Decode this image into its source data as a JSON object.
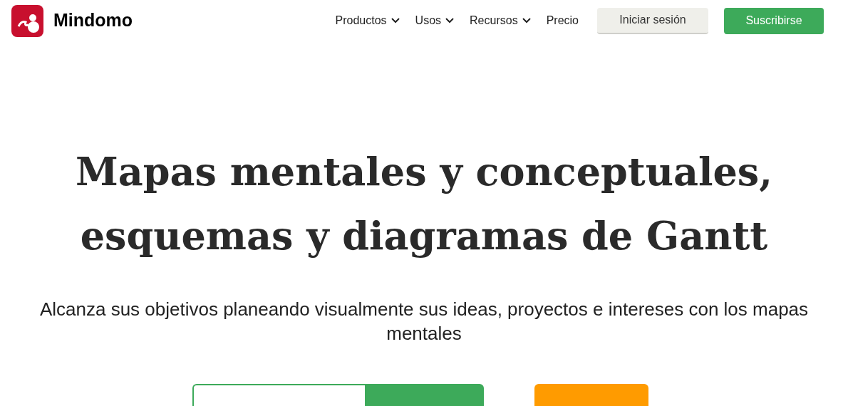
{
  "brand": {
    "name": "Mindomo"
  },
  "nav": [
    {
      "label": "Productos",
      "dropdown": true
    },
    {
      "label": "Usos",
      "dropdown": true
    },
    {
      "label": "Recursos",
      "dropdown": true
    },
    {
      "label": "Precio",
      "dropdown": false
    }
  ],
  "login_button": "Iniciar sesión",
  "subscribe_button": "Suscribirse",
  "hero": {
    "title_lines": [
      "Mapas mentales y conceptuales,",
      "esquemas y diagramas de Gantt"
    ],
    "subtitle": "Alcanza sus objetivos planeando visualmente sus ideas, proyectos e intereses con los mapas mentales"
  }
}
